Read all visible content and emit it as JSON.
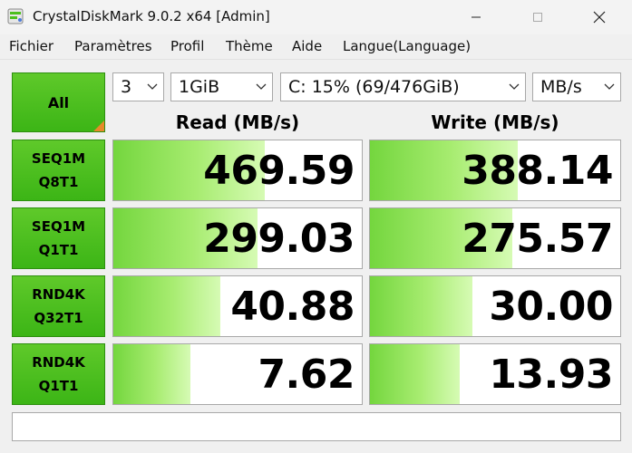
{
  "window": {
    "title": "CrystalDiskMark 9.0.2 x64 [Admin]"
  },
  "menu": [
    "Fichier",
    "Paramètres",
    "Profil",
    "Thème",
    "Aide",
    "Langue(Language)"
  ],
  "controls": {
    "all_label": "All",
    "count": "3",
    "size": "1GiB",
    "drive": "C: 15% (69/476GiB)",
    "unit": "MB/s"
  },
  "headers": {
    "read": "Read (MB/s)",
    "write": "Write (MB/s)"
  },
  "tests": [
    {
      "line1": "SEQ1M",
      "line2": "Q8T1",
      "read": "469.59",
      "write": "388.14",
      "read_fill": 0.61,
      "write_fill": 0.59
    },
    {
      "line1": "SEQ1M",
      "line2": "Q1T1",
      "read": "299.03",
      "write": "275.57",
      "read_fill": 0.58,
      "write_fill": 0.57
    },
    {
      "line1": "RND4K",
      "line2": "Q32T1",
      "read": "40.88",
      "write": "30.00",
      "read_fill": 0.43,
      "write_fill": 0.41
    },
    {
      "line1": "RND4K",
      "line2": "Q1T1",
      "read": "7.62",
      "write": "13.93",
      "read_fill": 0.31,
      "write_fill": 0.36
    }
  ],
  "comment": "",
  "colors": {
    "button_green": "#4cbf1e",
    "bar_green": "#74d63e",
    "corner_orange": "#e8892a"
  }
}
